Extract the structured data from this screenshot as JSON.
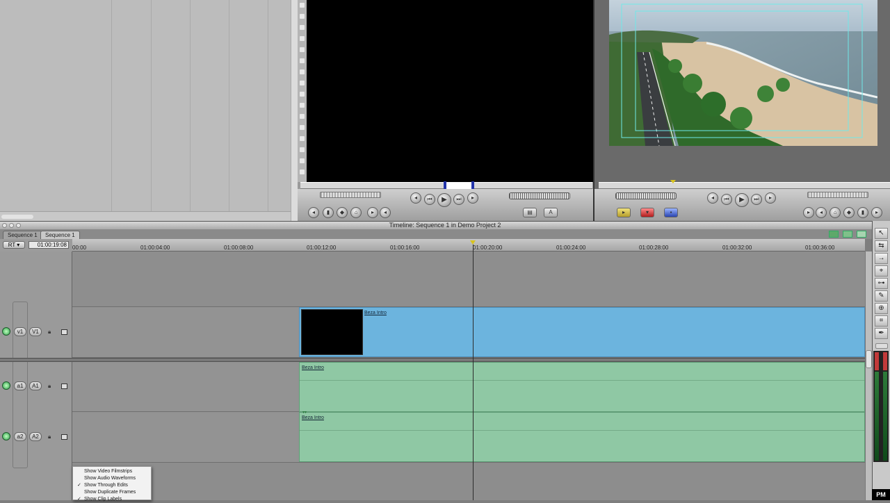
{
  "timeline": {
    "window_title": "Timeline: Sequence 1 in Demo Project 2",
    "tabs": [
      {
        "label": "Sequence 1",
        "active": false
      },
      {
        "label": "Sequence 1",
        "active": true
      }
    ],
    "rt_label": "RT",
    "timecode": "01:00:19:08",
    "ruler_labels": [
      "00:00",
      "01:00:04:00",
      "01:00:08:00",
      "01:00:12:00",
      "01:00:16:00",
      "01:00:20:00",
      "01:00:24:00",
      "01:00:28:00",
      "01:00:32:00",
      "01:00:36:00"
    ],
    "tracks": [
      {
        "source": "v1",
        "dest": "V1",
        "type": "video",
        "clip_label": "Beza Intro"
      },
      {
        "source": "a1",
        "dest": "A1",
        "type": "audio",
        "clip_label": "Beza Intro"
      },
      {
        "source": "a2",
        "dest": "A2",
        "type": "audio",
        "clip_label": "Beza Intro"
      }
    ]
  },
  "popup_menu": {
    "items": [
      {
        "label": "Show Video Filmstrips",
        "checked": false
      },
      {
        "label": "Show Audio Waveforms",
        "checked": false
      },
      {
        "label": "Show Through Edits",
        "checked": true
      },
      {
        "label": "Show Duplicate Frames",
        "checked": false
      },
      {
        "label": "Show Clip Labels",
        "checked": true
      }
    ]
  },
  "menubar_clock": "PM",
  "colors": {
    "video_clip": "#6cb4de",
    "audio_clip": "#8fc8a4",
    "title_safe": "#6fe8e8"
  }
}
